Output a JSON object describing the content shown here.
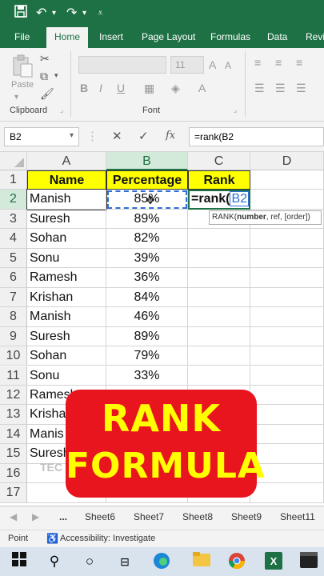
{
  "quick_access": {
    "save_icon": "save-icon",
    "undo_icon": "undo-icon",
    "redo_icon": "redo-icon",
    "customize_icon": "dropdown-icon"
  },
  "ribbon_tabs": [
    "File",
    "Home",
    "Insert",
    "Page Layout",
    "Formulas",
    "Data",
    "Revi"
  ],
  "active_tab": "Home",
  "ribbon": {
    "paste_label": "Paste",
    "font_size": "11",
    "groups": [
      "Clipboard",
      "Font"
    ]
  },
  "formula_bar": {
    "name_box": "B2",
    "formula": "=rank(B2",
    "fx_label": "fx"
  },
  "columns": [
    "A",
    "B",
    "C",
    "D"
  ],
  "rows": [
    "1",
    "2",
    "3",
    "4",
    "5",
    "6",
    "7",
    "8",
    "9",
    "10",
    "11",
    "12",
    "13",
    "14",
    "15",
    "16",
    "17"
  ],
  "header_row": {
    "name": "Name",
    "percentage": "Percentage",
    "rank": "Rank"
  },
  "data_rows": [
    {
      "name": "Manish",
      "pct": "85%"
    },
    {
      "name": "Suresh",
      "pct": "89%"
    },
    {
      "name": "Sohan",
      "pct": "82%"
    },
    {
      "name": "Sonu",
      "pct": "39%"
    },
    {
      "name": "Ramesh",
      "pct": "36%"
    },
    {
      "name": "Krishan",
      "pct": "84%"
    },
    {
      "name": "Manish",
      "pct": "46%"
    },
    {
      "name": "Suresh",
      "pct": "89%"
    },
    {
      "name": "Sohan",
      "pct": "79%"
    },
    {
      "name": "Sonu",
      "pct": "33%"
    },
    {
      "name": "Ramesh",
      "pct": ""
    },
    {
      "name": "Krisha",
      "pct": ""
    },
    {
      "name": "Manis",
      "pct": ""
    },
    {
      "name": "Suresh",
      "pct": ""
    }
  ],
  "editing_cell": {
    "prefix": "=rank(",
    "ref": "B2"
  },
  "tooltip": {
    "fn": "RANK(",
    "arg_bold": "number",
    "rest": ", ref, [order])"
  },
  "overlay": {
    "line1": "RANK",
    "line2": "FORMULA"
  },
  "sheet_tabs": [
    "...",
    "Sheet6",
    "Sheet7",
    "Sheet8",
    "Sheet9",
    "Sheet11"
  ],
  "status": {
    "mode": "Point",
    "accessibility": "Accessibility: Investigate"
  },
  "colors": {
    "excel_green": "#1e7145",
    "header_yellow": "#ffff00",
    "overlay_red": "#e8141e",
    "overlay_text": "#ffff00",
    "ref_blue": "#2f6fd6"
  }
}
